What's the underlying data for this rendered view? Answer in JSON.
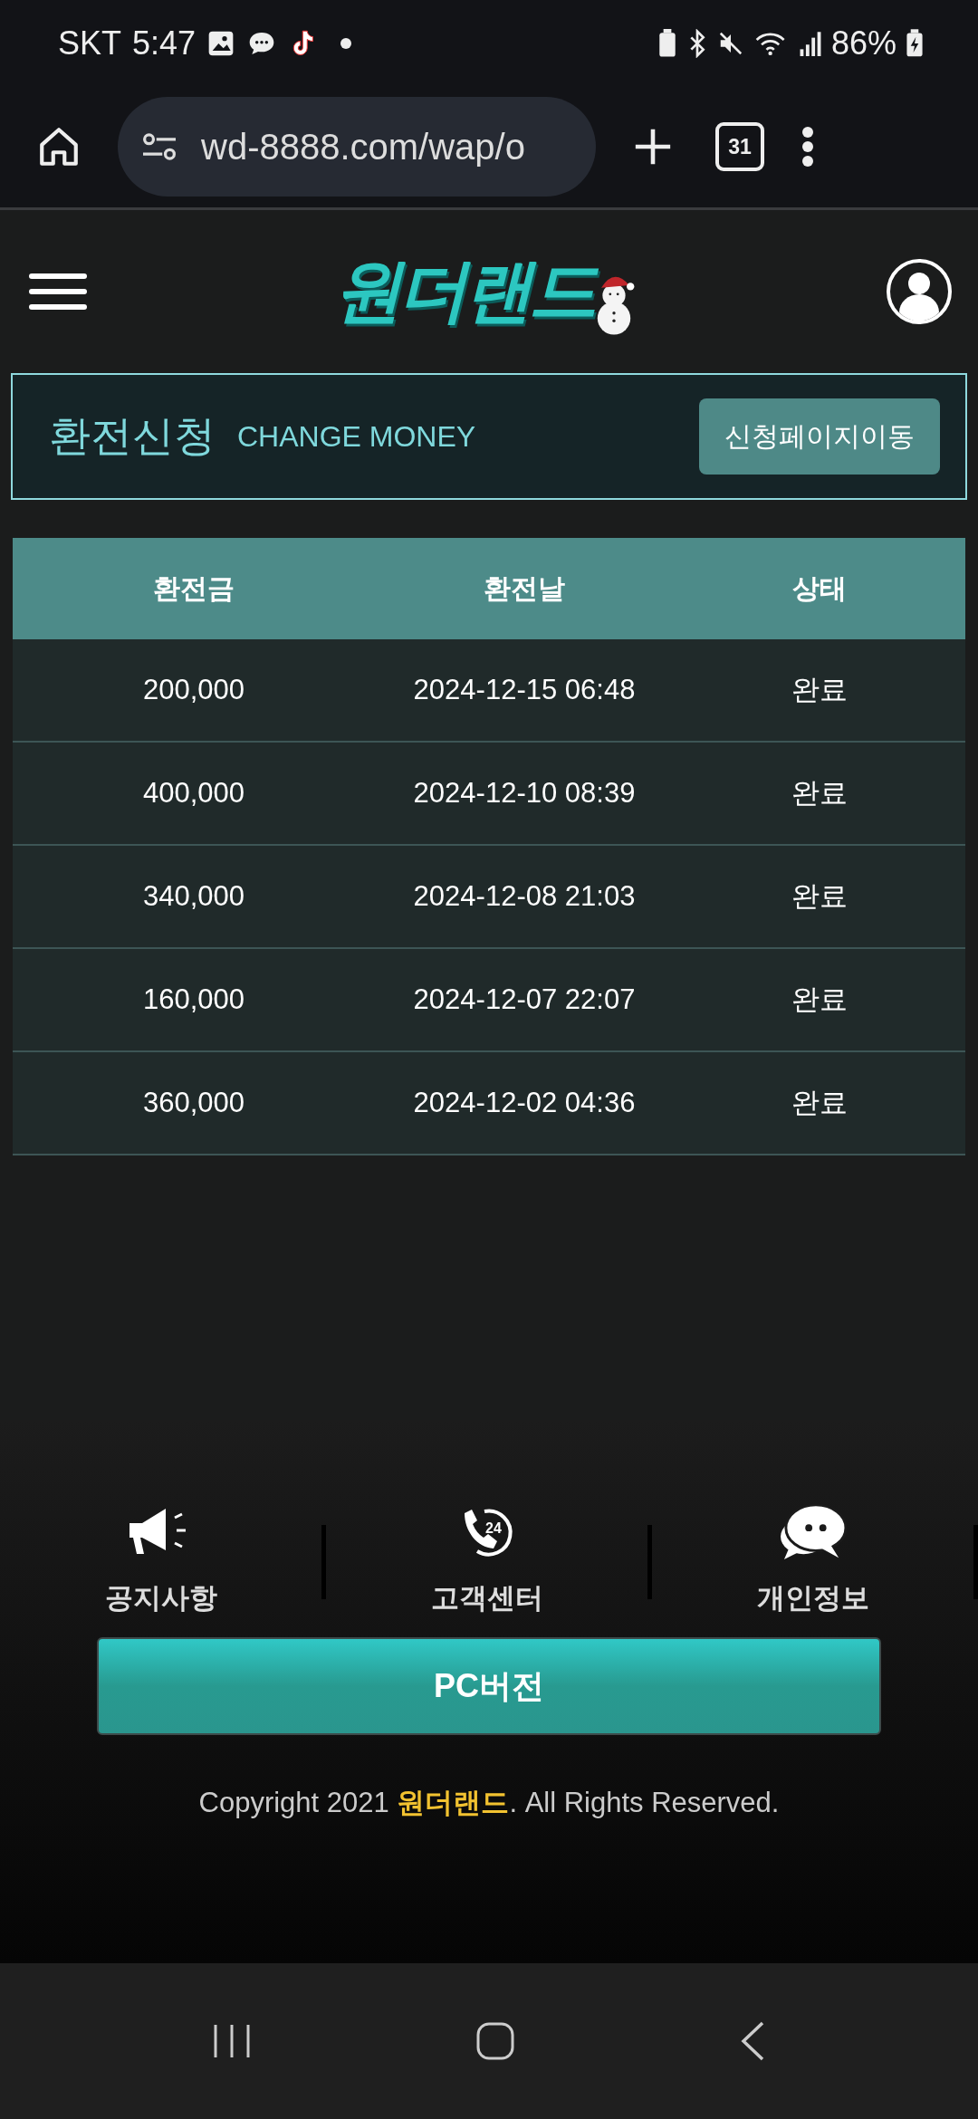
{
  "status_bar": {
    "carrier": "SKT",
    "time": "5:47",
    "battery": "86%"
  },
  "browser": {
    "url": "wd-8888.com/wap/o",
    "tab_count": "31"
  },
  "header": {
    "logo": "원더랜드"
  },
  "panel": {
    "title": "환전신청",
    "subtitle": "CHANGE MONEY",
    "button": "신청페이지이동"
  },
  "table": {
    "columns": [
      "환전금",
      "환전날",
      "상태"
    ],
    "rows": [
      {
        "amount": "200,000",
        "date": "2024-12-15 06:48",
        "status": "완료"
      },
      {
        "amount": "400,000",
        "date": "2024-12-10 08:39",
        "status": "완료"
      },
      {
        "amount": "340,000",
        "date": "2024-12-08 21:03",
        "status": "완료"
      },
      {
        "amount": "160,000",
        "date": "2024-12-07 22:07",
        "status": "완료"
      },
      {
        "amount": "360,000",
        "date": "2024-12-02 04:36",
        "status": "완료"
      }
    ]
  },
  "footer": {
    "links": [
      {
        "kind": "notice",
        "label": "공지사항"
      },
      {
        "kind": "support",
        "label": "고객센터",
        "icon_text": "24"
      },
      {
        "kind": "privacy",
        "label": "개인정보"
      }
    ],
    "pc_button": "PC버전",
    "copyright": "Copyright 2021 **원더랜드**. All Rights Reserved."
  }
}
